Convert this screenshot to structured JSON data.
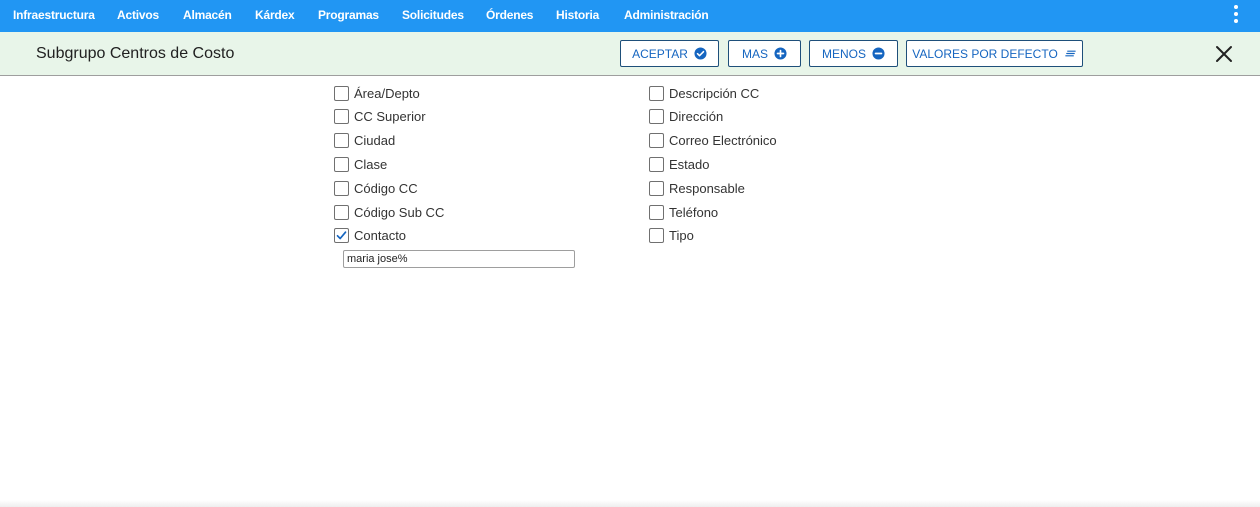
{
  "nav": {
    "items": [
      {
        "label": "Infraestructura"
      },
      {
        "label": "Activos"
      },
      {
        "label": "Almacén"
      },
      {
        "label": "Kárdex"
      },
      {
        "label": "Programas"
      },
      {
        "label": "Solicitudes"
      },
      {
        "label": "Órdenes"
      },
      {
        "label": "Historia"
      },
      {
        "label": "Administración"
      }
    ],
    "menu_icon": "kebab-menu-icon",
    "bar_color": "#2196f3"
  },
  "header": {
    "title": "Subgrupo Centros de Costo",
    "background": "#e8f5e9",
    "buttons": {
      "accept": {
        "label": "ACEPTAR",
        "icon": "check-circle-icon"
      },
      "more": {
        "label": "MAS",
        "icon": "plus-circle-icon"
      },
      "less": {
        "label": "MENOS",
        "icon": "minus-circle-icon"
      },
      "defaults": {
        "label": "VALORES POR DEFECTO",
        "icon": "lines-icon"
      }
    },
    "close_icon": "close-icon"
  },
  "fields": {
    "left": [
      {
        "label": "Área/Depto",
        "checked": false
      },
      {
        "label": "CC Superior",
        "checked": false
      },
      {
        "label": "Ciudad",
        "checked": false
      },
      {
        "label": "Clase",
        "checked": false
      },
      {
        "label": "Código CC",
        "checked": false
      },
      {
        "label": "Código Sub CC",
        "checked": false
      },
      {
        "label": "Contacto",
        "checked": true
      }
    ],
    "right": [
      {
        "label": "Descripción CC",
        "checked": false
      },
      {
        "label": "Dirección",
        "checked": false
      },
      {
        "label": "Correo Electrónico",
        "checked": false
      },
      {
        "label": "Estado",
        "checked": false
      },
      {
        "label": "Responsable",
        "checked": false
      },
      {
        "label": "Teléfono",
        "checked": false
      },
      {
        "label": "Tipo",
        "checked": false
      }
    ],
    "contacto_value": "maria jose%"
  }
}
